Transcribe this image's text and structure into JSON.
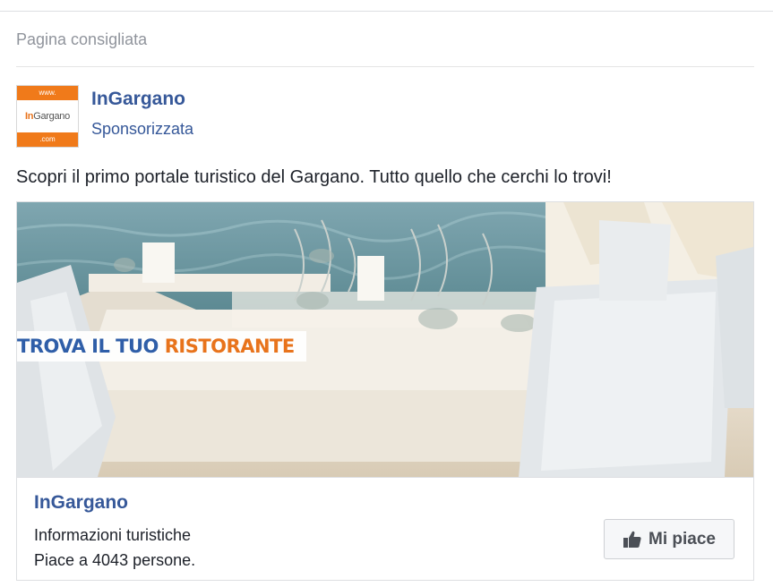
{
  "section": {
    "title": "Pagina consigliata"
  },
  "logo": {
    "top_text": "www.",
    "brand_prefix": "In",
    "brand_suffix": "Gargano",
    "bottom_text": ".com",
    "brand_color": "#e8731b"
  },
  "post": {
    "page_name": "InGargano",
    "sponsored_label": "Sponsorizzata",
    "text": "Scopri il primo portale turistico del Gargano. Tutto quello che cerchi lo trovi!"
  },
  "media": {
    "banner_part1": "TROVA IL TUO ",
    "banner_part2": "RISTORANTE",
    "banner_blue": "#2f5ea8",
    "banner_orange": "#e8731b"
  },
  "footer": {
    "page_name": "InGargano",
    "category": "Informazioni turistiche",
    "likes": "Piace a 4043 persone.",
    "like_button_label": "Mi piace",
    "like_icon": "thumbs-up-icon"
  },
  "colors": {
    "link_blue": "#365899",
    "text": "#1d2129",
    "muted": "#90949c"
  }
}
